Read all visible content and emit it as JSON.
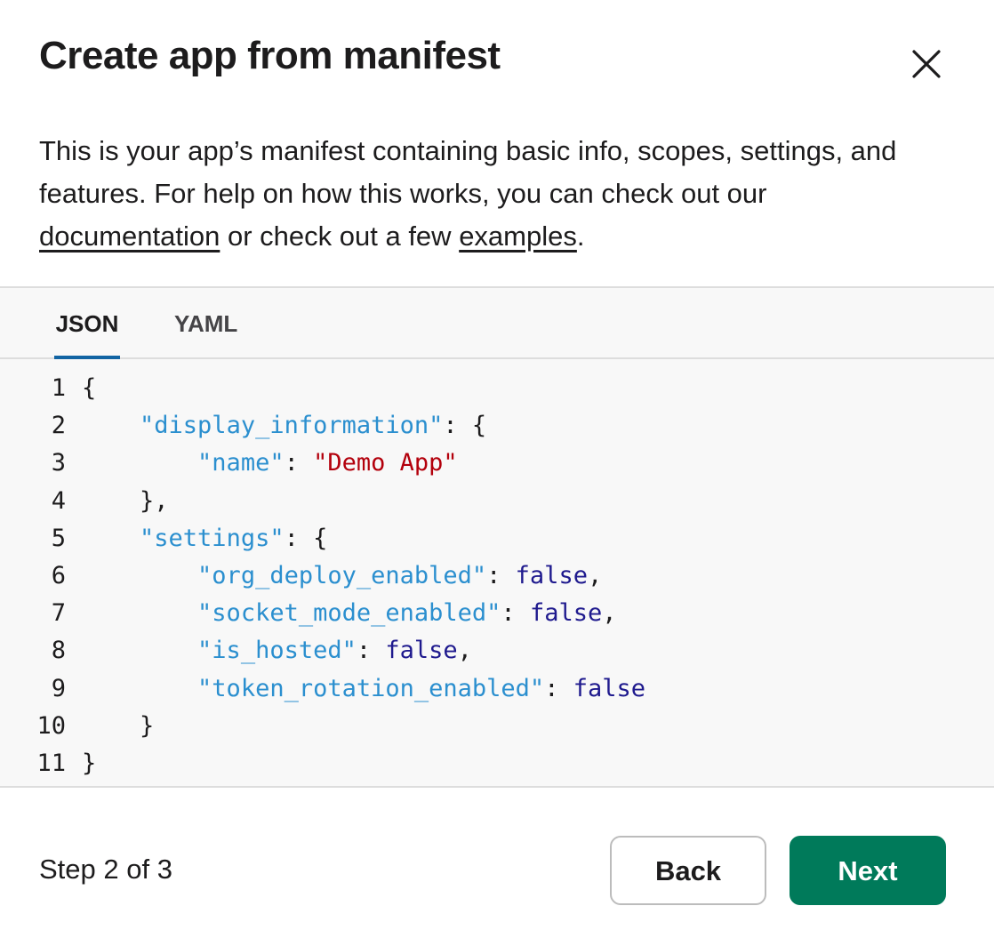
{
  "modal": {
    "title": "Create app from manifest",
    "close_icon": "close-icon"
  },
  "description": {
    "part1": "This is your app’s manifest containing basic info, scopes, settings, and features. For help on how this works, you can check out our ",
    "link_documentation": "documentation",
    "part2": " or check out a few ",
    "link_examples": "examples",
    "part3": "."
  },
  "tabs": [
    {
      "label": "JSON",
      "active": true
    },
    {
      "label": "YAML",
      "active": false
    }
  ],
  "code": {
    "line_numbers": [
      "1",
      "2",
      "3",
      "4",
      "5",
      "6",
      "7",
      "8",
      "9",
      "10",
      "11"
    ],
    "lines": [
      {
        "indent": "",
        "tokens": [
          {
            "t": "p",
            "v": "{"
          }
        ]
      },
      {
        "indent": "    ",
        "tokens": [
          {
            "t": "k",
            "v": "\"display_information\""
          },
          {
            "t": "p",
            "v": ": {"
          }
        ]
      },
      {
        "indent": "        ",
        "tokens": [
          {
            "t": "k",
            "v": "\"name\""
          },
          {
            "t": "p",
            "v": ": "
          },
          {
            "t": "s",
            "v": "\"Demo App\""
          }
        ]
      },
      {
        "indent": "    ",
        "tokens": [
          {
            "t": "p",
            "v": "},"
          }
        ]
      },
      {
        "indent": "    ",
        "tokens": [
          {
            "t": "k",
            "v": "\"settings\""
          },
          {
            "t": "p",
            "v": ": {"
          }
        ]
      },
      {
        "indent": "        ",
        "tokens": [
          {
            "t": "k",
            "v": "\"org_deploy_enabled\""
          },
          {
            "t": "p",
            "v": ": "
          },
          {
            "t": "b",
            "v": "false"
          },
          {
            "t": "p",
            "v": ","
          }
        ]
      },
      {
        "indent": "        ",
        "tokens": [
          {
            "t": "k",
            "v": "\"socket_mode_enabled\""
          },
          {
            "t": "p",
            "v": ": "
          },
          {
            "t": "b",
            "v": "false"
          },
          {
            "t": "p",
            "v": ","
          }
        ]
      },
      {
        "indent": "        ",
        "tokens": [
          {
            "t": "k",
            "v": "\"is_hosted\""
          },
          {
            "t": "p",
            "v": ": "
          },
          {
            "t": "b",
            "v": "false"
          },
          {
            "t": "p",
            "v": ","
          }
        ]
      },
      {
        "indent": "        ",
        "tokens": [
          {
            "t": "k",
            "v": "\"token_rotation_enabled\""
          },
          {
            "t": "p",
            "v": ": "
          },
          {
            "t": "b",
            "v": "false"
          }
        ]
      },
      {
        "indent": "    ",
        "tokens": [
          {
            "t": "p",
            "v": "}"
          }
        ]
      },
      {
        "indent": "",
        "tokens": [
          {
            "t": "p",
            "v": "}"
          }
        ]
      }
    ]
  },
  "footer": {
    "step_text": "Step 2 of 3",
    "back_label": "Back",
    "next_label": "Next"
  },
  "colors": {
    "accent_tab": "#1264a3",
    "primary_button": "#007a5a",
    "json_key": "#2b8fcf",
    "json_string": "#b3000c",
    "json_boolean": "#1f1a8e"
  }
}
